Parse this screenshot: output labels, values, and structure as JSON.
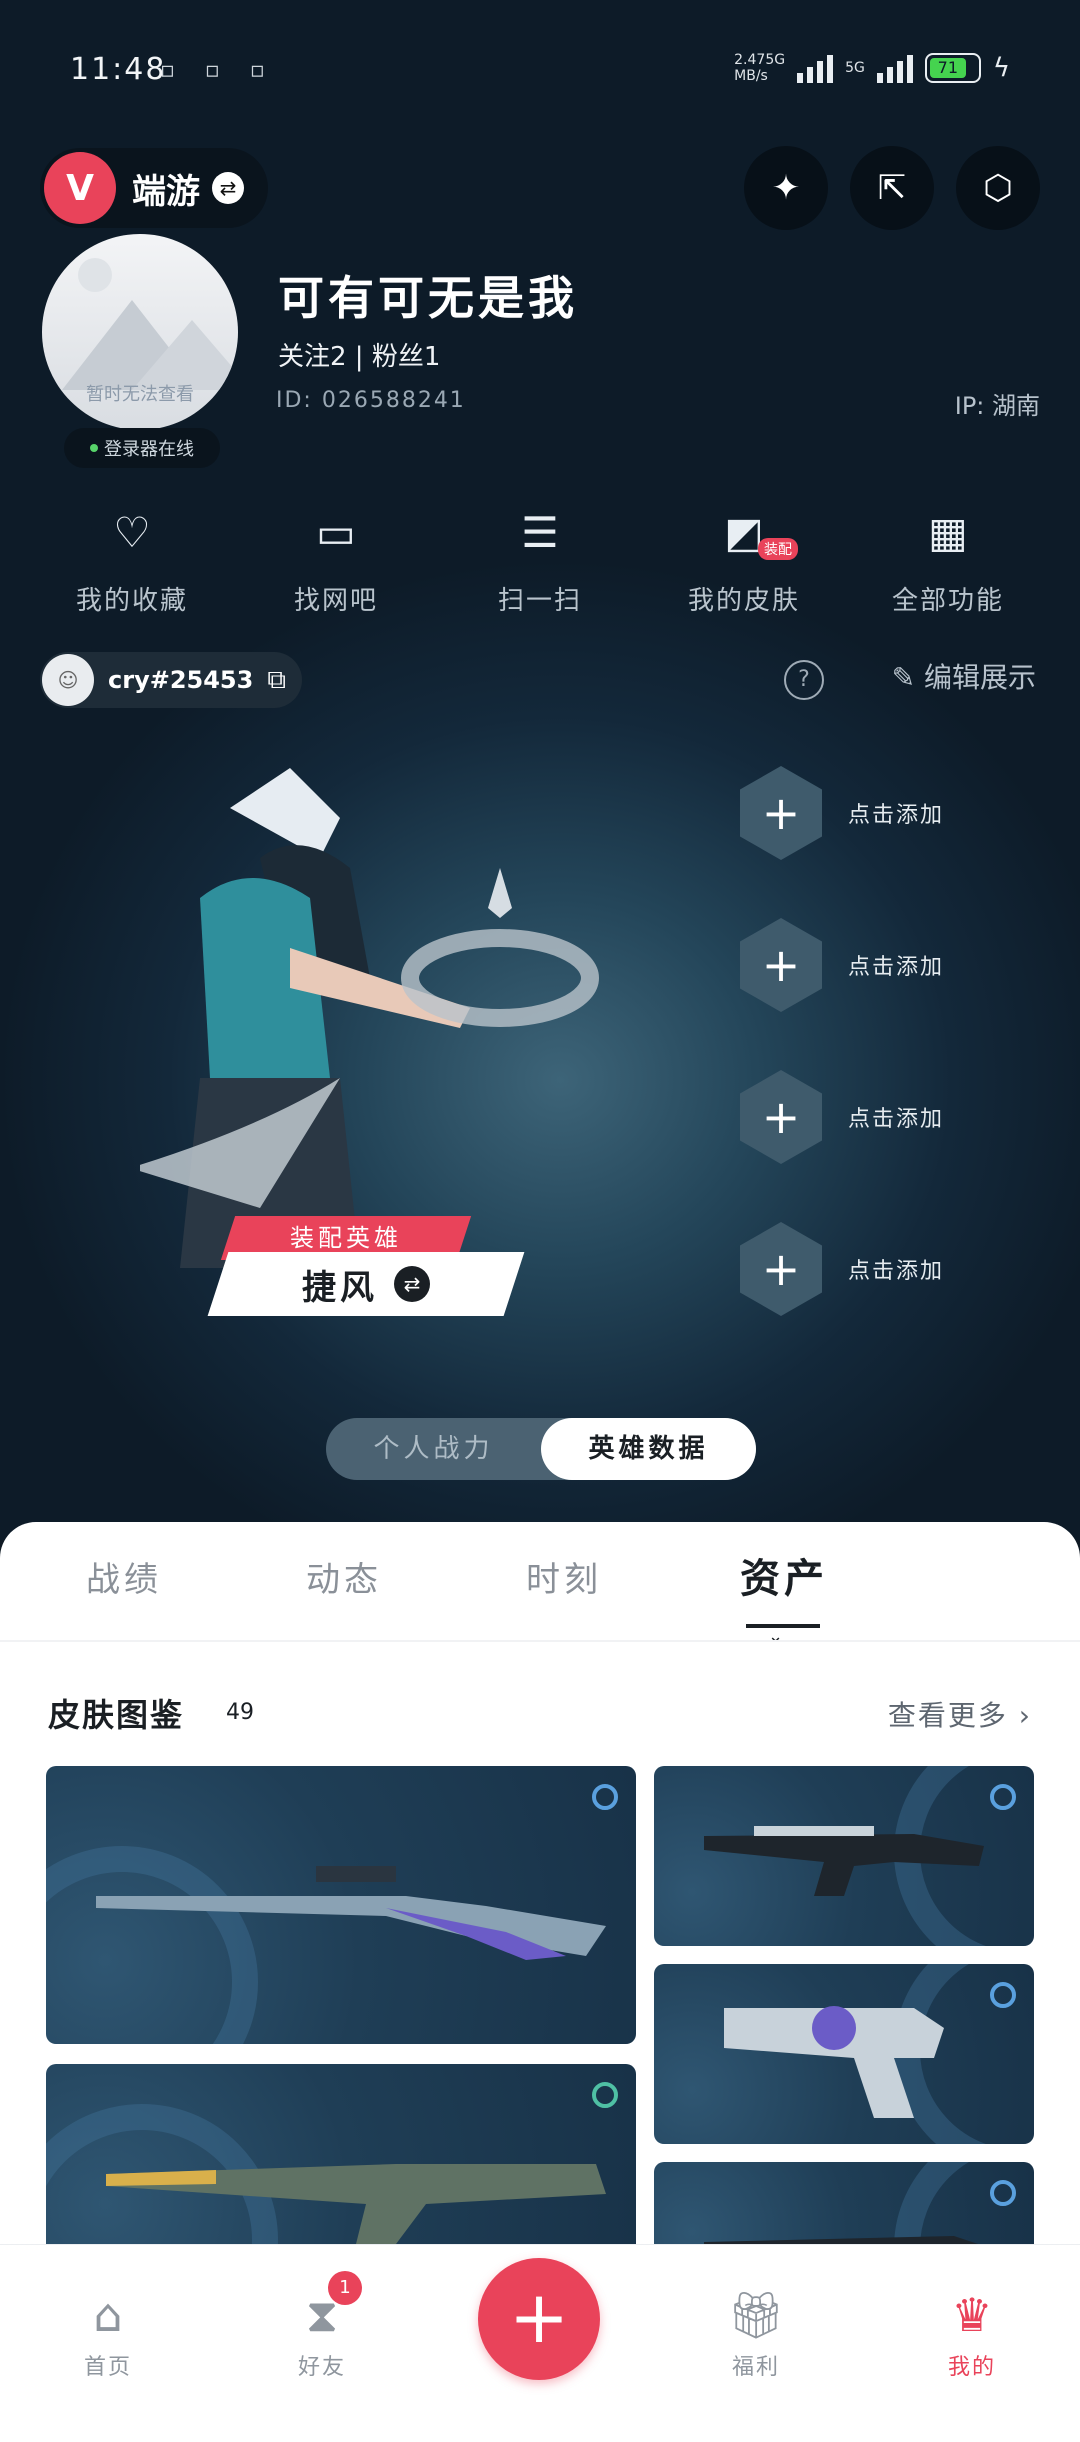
{
  "status": {
    "time": "11:48",
    "net_speed": "2.47\nMB/s",
    "net_type_1": "5G",
    "net_type_2": "5G",
    "battery": "71"
  },
  "header": {
    "app_name": "端游",
    "icons": [
      "add-photo-icon",
      "share-icon",
      "settings-icon"
    ]
  },
  "profile": {
    "avatar_caption": "暂时无法查看",
    "online_status": "登录器在线",
    "username": "可有可无是我",
    "follow_text": "关注2  |  粉丝1",
    "id_text": "ID:  026588241",
    "ip_text": "IP:  湖南"
  },
  "quick_menu": [
    {
      "label": "我的收藏",
      "icon": "heart-icon"
    },
    {
      "label": "找网吧",
      "icon": "monitor-icon"
    },
    {
      "label": "扫一扫",
      "icon": "scan-icon"
    },
    {
      "label": "我的皮肤",
      "icon": "skin-icon",
      "badge": "装配"
    },
    {
      "label": "全部功能",
      "icon": "grid-icon"
    }
  ],
  "player_tag": "cry#25453",
  "edit_display": "编辑展示",
  "agent": {
    "equip_label": "装配英雄",
    "name": "捷风"
  },
  "slots": [
    "点击添加",
    "点击添加",
    "点击添加",
    "点击添加"
  ],
  "toggle": {
    "left": "个人战力",
    "right": "英雄数据"
  },
  "tabs": [
    "战绩",
    "动态",
    "时刻",
    "资产"
  ],
  "skins": {
    "title": "皮肤图鉴",
    "count": "49",
    "more": "查看更多"
  },
  "bottom_nav": [
    {
      "label": "首页",
      "icon": "home-icon"
    },
    {
      "label": "好友",
      "icon": "friends-icon",
      "badge": "1"
    },
    {
      "label": "福利",
      "icon": "gift-icon"
    },
    {
      "label": "我的",
      "icon": "profile-icon",
      "active": true
    }
  ],
  "accent_color": "#e9435a"
}
